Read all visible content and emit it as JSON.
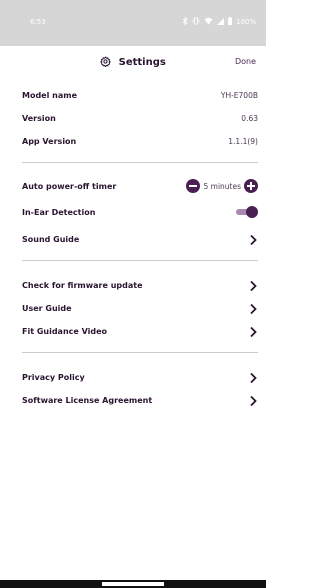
{
  "status_bar": {
    "time": "6:53",
    "battery": "100%",
    "icons": [
      "bluetooth-icon",
      "vibrate-icon",
      "wifi-icon",
      "signal-icon",
      "battery-icon"
    ]
  },
  "header": {
    "title": "Settings",
    "done_label": "Done"
  },
  "info": {
    "model_name_label": "Model name",
    "model_name_value": "YH-E700B",
    "version_label": "Version",
    "version_value": "0.63",
    "app_version_label": "App Version",
    "app_version_value": "1.1.1(9)"
  },
  "controls": {
    "auto_off_label": "Auto power-off timer",
    "auto_off_value": "5 minutes",
    "in_ear_label": "In-Ear Detection",
    "in_ear_enabled": true,
    "sound_guide_label": "Sound Guide"
  },
  "links": {
    "firmware_label": "Check for firmware update",
    "user_guide_label": "User Guide",
    "fit_video_label": "Fit Guidance Video"
  },
  "legal": {
    "privacy_label": "Privacy Policy",
    "license_label": "Software License Agreement"
  },
  "colors": {
    "accent": "#4a1f52",
    "status_bar_bg": "#d6d6d6",
    "divider": "#cfc7d2"
  }
}
